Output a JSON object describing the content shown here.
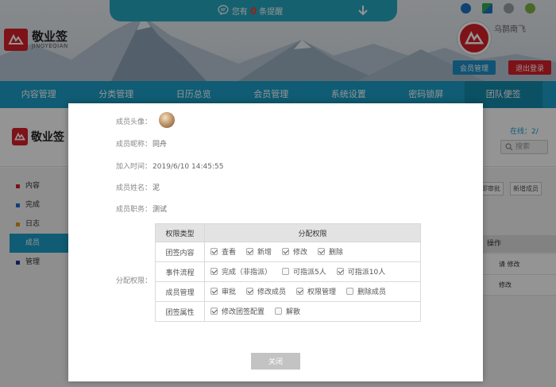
{
  "header": {
    "logo_cn": "敬业签",
    "logo_en": "JINGYEQIAN",
    "notice_prefix": "您有",
    "notice_count": "0",
    "notice_suffix": "条提醒",
    "username": "乌鹊南飞",
    "member_btn": "会员管理",
    "logout_btn": "退出登录",
    "platforms": [
      "ie-icon",
      "windows-icon",
      "apple-icon",
      "android-icon"
    ]
  },
  "nav": [
    "内容管理",
    "分类管理",
    "日历总览",
    "会员管理",
    "系统设置",
    "密码锁屏",
    "团队便签"
  ],
  "subbar": {
    "logo": "敬业签",
    "online": "在线：2/",
    "search_placeholder": "搜索"
  },
  "sidebar": [
    {
      "label": "内容",
      "color": "#d7202a"
    },
    {
      "label": "完成",
      "color": "#1e6fd0"
    },
    {
      "label": "日志",
      "color": "#e09a1a"
    },
    {
      "label": "成员",
      "color": "#ffffff"
    },
    {
      "label": "管理",
      "color": "#1a3c8a"
    }
  ],
  "bg_buttons": [
    "即审批",
    "新增成员"
  ],
  "bg_table": {
    "header": "操作",
    "rows": [
      "请   修改",
      "修改"
    ]
  },
  "modal": {
    "fields": [
      {
        "label": "成员头像：",
        "value": ""
      },
      {
        "label": "成员昵称：",
        "value": "同舟"
      },
      {
        "label": "加入时间：",
        "value": "2019/6/10 14:45:55"
      },
      {
        "label": "成员姓名：",
        "value": "泥"
      },
      {
        "label": "成员职务：",
        "value": "测试"
      }
    ],
    "perm_label": "分配权限：",
    "table_headers": [
      "权限类型",
      "分配权限"
    ],
    "permissions": [
      {
        "type": "团签内容",
        "options": [
          {
            "label": "查看",
            "checked": true
          },
          {
            "label": "新增",
            "checked": true
          },
          {
            "label": "修改",
            "checked": true
          },
          {
            "label": "删除",
            "checked": true
          }
        ]
      },
      {
        "type": "事件流程",
        "options": [
          {
            "label": "完成（非指派）",
            "checked": true
          },
          {
            "label": "可指派5人",
            "checked": false
          },
          {
            "label": "可指派10人",
            "checked": true
          }
        ]
      },
      {
        "type": "成员管理",
        "options": [
          {
            "label": "审批",
            "checked": true
          },
          {
            "label": "修改成员",
            "checked": true
          },
          {
            "label": "权限管理",
            "checked": true
          },
          {
            "label": "删除成员",
            "checked": false
          }
        ]
      },
      {
        "type": "团签属性",
        "options": [
          {
            "label": "修改团签配置",
            "checked": true
          },
          {
            "label": "解散",
            "checked": false
          }
        ]
      }
    ],
    "close_btn": "关闭"
  }
}
